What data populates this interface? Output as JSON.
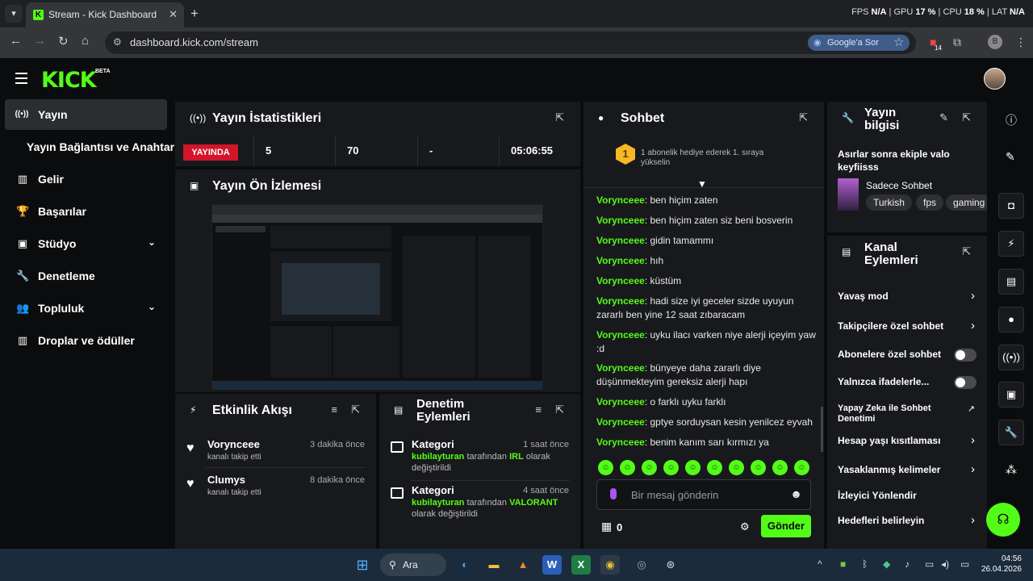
{
  "browser": {
    "tab_title": "Stream - Kick Dashboard",
    "tab_favicon": "K",
    "new_tab": "+",
    "url": "dashboard.kick.com/stream",
    "google_btn": "Google'a Sor",
    "ext_badge": "14",
    "profile_initial": "B",
    "perf": {
      "fps_label": "FPS",
      "fps": "N/A",
      "gpu_label": "GPU",
      "gpu": "17 %",
      "cpu_label": "CPU",
      "cpu": "18 %",
      "lat_label": "LAT",
      "lat": "N/A"
    }
  },
  "header": {
    "logo": "KICK",
    "beta": "BETA"
  },
  "sidebar": {
    "items": [
      {
        "label": "Yayın",
        "icon": "((•))"
      },
      {
        "label": "Yayın Bağlantısı ve Anahtarı",
        "icon": ""
      },
      {
        "label": "Gelir",
        "icon": "▥"
      },
      {
        "label": "Başarılar",
        "icon": "🏆"
      },
      {
        "label": "Stüdyo",
        "icon": "▣"
      },
      {
        "label": "Denetleme",
        "icon": "🔧"
      },
      {
        "label": "Topluluk",
        "icon": "👥"
      },
      {
        "label": "Droplar ve ödüller",
        "icon": "▥"
      }
    ]
  },
  "stats": {
    "title": "Yayın İstatistikleri",
    "live_badge": "YAYINDA",
    "viewers": "5",
    "followers": "70",
    "subs": "-",
    "uptime": "05:06:55"
  },
  "preview": {
    "title": "Yayın Ön İzlemesi"
  },
  "activity": {
    "title": "Etkinlik Akışı",
    "items": [
      {
        "name": "Vorynceee",
        "desc": "kanalı takip etti",
        "time": "3 dakika önce"
      },
      {
        "name": "Clumys",
        "desc": "kanalı takip etti",
        "time": "8 dakika önce"
      }
    ]
  },
  "moderation": {
    "title": "Denetim Eylemleri",
    "items": [
      {
        "name": "Kategori",
        "time": "1 saat önce",
        "user": "kubilayturan",
        "mid": " tarafından ",
        "value": "IRL",
        "end1": " olarak",
        "end2": "değiştirildi"
      },
      {
        "name": "Kategori",
        "time": "4 saat önce",
        "user": "kubilayturan",
        "mid": " tarafından ",
        "value": "VALORANT",
        "end1": "",
        "end2": "olarak değiştirildi"
      }
    ]
  },
  "chat": {
    "title": "Sohbet",
    "gift_rank": "1",
    "gift_text": "1 abonelik hediye ederek 1. sıraya yükselin",
    "messages": [
      {
        "user": "Vorynceee",
        "text": "ben hiçim zaten"
      },
      {
        "user": "Vorynceee",
        "text": "ben hiçim zaten siz beni bosverin"
      },
      {
        "user": "Vorynceee",
        "text": "gidin tamammı"
      },
      {
        "user": "Vorynceee",
        "text": "hıh"
      },
      {
        "user": "Vorynceee",
        "text": "küstüm"
      },
      {
        "user": "Vorynceee",
        "text": "hadi size iyi geceler sizde uyuyun zararlı ben yine 12 saat zıbaracam"
      },
      {
        "user": "Vorynceee",
        "text": "uyku ilacı varken niye alerji içeyim yaw :d"
      },
      {
        "user": "Vorynceee",
        "text": "bünyeye daha zararlı diye düşünmekteyim gereksiz alerji hapı"
      },
      {
        "user": "Vorynceee",
        "text": "o farklı uyku farklı"
      },
      {
        "user": "Vorynceee",
        "text": "gptye sorduysan kesin yenilcez eyvah"
      },
      {
        "user": "Vorynceee",
        "text": "benim kanım sarı kırmızı ya"
      }
    ],
    "placeholder": "Bir mesaj gönderin",
    "points": "0",
    "send": "Gönder"
  },
  "info": {
    "title_l1": "Yayın",
    "title_l2": "bilgisi",
    "stream_title": "Asırlar sonra ekiple valo keyfiisss",
    "mode": "Sadece Sohbet",
    "tags": [
      "Turkish",
      "fps",
      "gaming"
    ]
  },
  "channel": {
    "title_l1": "Kanal",
    "title_l2": "Eylemleri",
    "actions": [
      {
        "label": "Yavaş mod",
        "type": "chevron"
      },
      {
        "label": "Takipçilere özel sohbet",
        "type": "chevron"
      },
      {
        "label": "Abonelere özel sohbet",
        "type": "toggle"
      },
      {
        "label": "Yalnızca ifadelerle...",
        "type": "toggle"
      },
      {
        "label": "Yapay Zeka ile Sohbet Denetimi",
        "type": "external"
      },
      {
        "label": "Hesap yaşı kısıtlaması",
        "type": "chevron"
      },
      {
        "label": "Yasaklanmış kelimeler",
        "type": "chevron"
      },
      {
        "label": "İzleyici Yönlendir",
        "type": "none"
      },
      {
        "label": "Hedefleri belirleyin",
        "type": "chevron"
      }
    ]
  },
  "taskbar": {
    "search": "Ara",
    "time": "04:56",
    "date": "26.04.2026"
  }
}
